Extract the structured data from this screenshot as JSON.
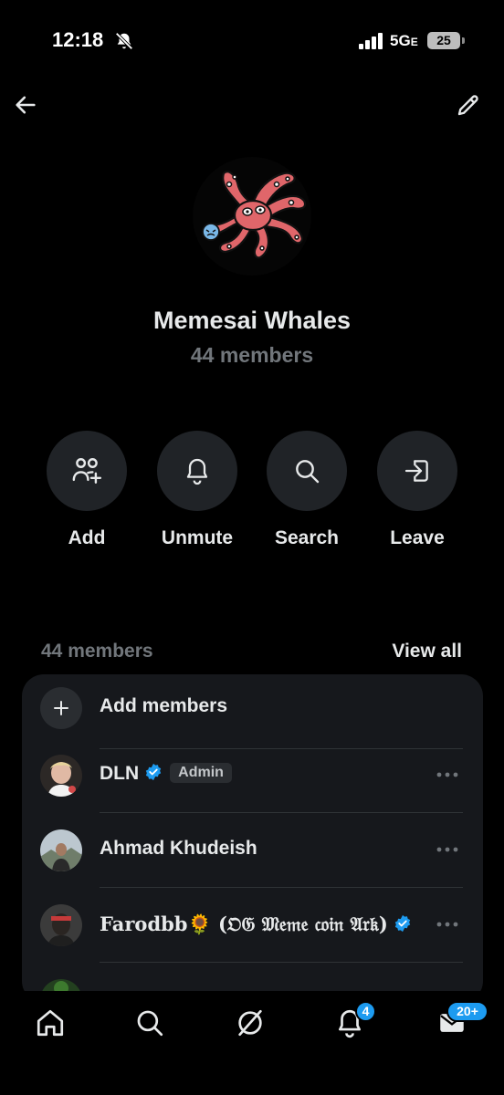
{
  "status_bar": {
    "time": "12:18",
    "network": "5G",
    "network_suffix": "E",
    "battery": "25"
  },
  "header": {
    "back_icon": "back-arrow-icon",
    "edit_icon": "pencil-icon"
  },
  "group": {
    "name": "Memesai Whales",
    "member_count_label": "44 members"
  },
  "actions": [
    {
      "label": "Add",
      "icon": "add-people-icon"
    },
    {
      "label": "Unmute",
      "icon": "bell-icon"
    },
    {
      "label": "Search",
      "icon": "search-icon"
    },
    {
      "label": "Leave",
      "icon": "leave-icon"
    }
  ],
  "members_section": {
    "count_label": "44 members",
    "view_all": "View all",
    "add_members": "Add members",
    "members": [
      {
        "name": "DLN",
        "verified": true,
        "badge": "Admin"
      },
      {
        "name": "Ahmad Khudeish",
        "verified": false,
        "badge": ""
      },
      {
        "name": "Farodbb🌻 (𝔒𝔊 𝔐𝔢𝔪𝔢 𝔠𝔬𝔦𝔫 𝔄𝔯𝔨)",
        "verified": true,
        "badge": ""
      }
    ]
  },
  "bottom_nav": {
    "notifications_badge": "4",
    "messages_badge": "20+"
  },
  "colors": {
    "background": "#000000",
    "card": "#16181c",
    "accent": "#1d9bf0",
    "muted_text": "#71767b"
  }
}
